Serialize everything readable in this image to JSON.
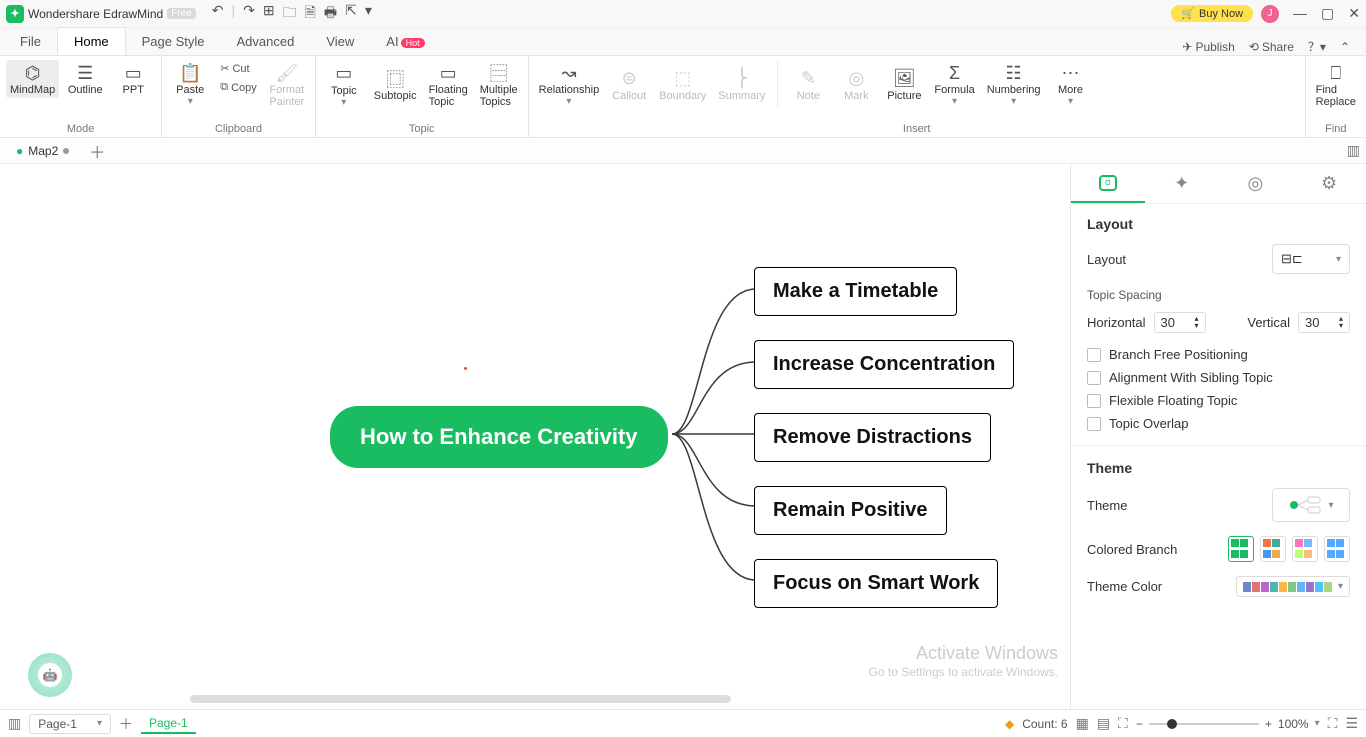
{
  "app": {
    "product": "Wondershare EdrawMind",
    "edition_badge": "Free",
    "buy_now": "Buy Now",
    "avatar_initial": "J"
  },
  "menu": {
    "items": [
      "File",
      "Home",
      "Page Style",
      "Advanced",
      "View"
    ],
    "active": "Home",
    "ai_label": "AI",
    "ai_badge": "Hot",
    "publish": "Publish",
    "share": "Share"
  },
  "ribbon": {
    "mode_group": "Mode",
    "mindmap": "MindMap",
    "outline": "Outline",
    "ppt": "PPT",
    "clipboard_group": "Clipboard",
    "paste": "Paste",
    "cut": "Cut",
    "copy": "Copy",
    "format_painter": "Format\nPainter",
    "topic_group": "Topic",
    "topic": "Topic",
    "subtopic": "Subtopic",
    "floating_topic": "Floating\nTopic",
    "multiple_topics": "Multiple\nTopics",
    "insert_group": "Insert",
    "relationship": "Relationship",
    "callout": "Callout",
    "boundary": "Boundary",
    "summary": "Summary",
    "note": "Note",
    "mark": "Mark",
    "picture": "Picture",
    "formula": "Formula",
    "numbering": "Numbering",
    "more": "More",
    "find_group": "Find",
    "find_replace": "Find\nReplace"
  },
  "tabs": {
    "map_name": "Map2"
  },
  "mindmap": {
    "central": "How to Enhance Creativity",
    "children": [
      "Make a Timetable",
      "Increase Concentration",
      "Remove Distractions",
      "Remain Positive",
      "Focus on Smart Work"
    ]
  },
  "side": {
    "layout_h": "Layout",
    "layout_label": "Layout",
    "topic_spacing": "Topic Spacing",
    "horizontal": "Horizontal",
    "h_val": "30",
    "vertical": "Vertical",
    "v_val": "30",
    "branch_free": "Branch Free Positioning",
    "align_sibling": "Alignment With Sibling Topic",
    "flex_float": "Flexible Floating Topic",
    "topic_overlap": "Topic Overlap",
    "theme_h": "Theme",
    "theme_label": "Theme",
    "colored_branch": "Colored Branch",
    "theme_color": "Theme Color"
  },
  "status": {
    "page_dd": "Page-1",
    "page_tab": "Page-1",
    "count_label": "Count: 6",
    "zoom": "100%"
  },
  "watermark": {
    "l1": "Activate Windows",
    "l2": "Go to Settings to activate Windows."
  }
}
